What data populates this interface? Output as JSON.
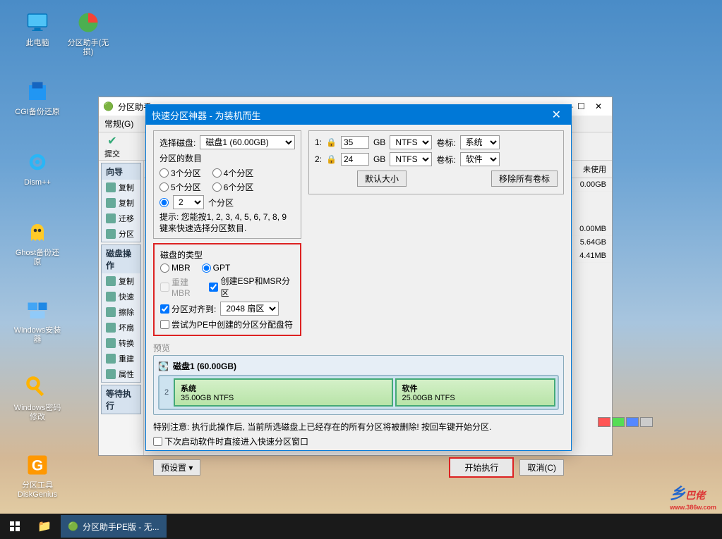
{
  "desktop": {
    "icons": [
      {
        "label": "此电脑",
        "icon": "pc"
      },
      {
        "label": "分区助手(无损)",
        "icon": "partition"
      },
      {
        "label": "CGI备份还原",
        "icon": "cgi"
      },
      {
        "label": "Dism++",
        "icon": "gear"
      },
      {
        "label": "Ghost备份还原",
        "icon": "ghost"
      },
      {
        "label": "Windows安装器",
        "icon": "win-install"
      },
      {
        "label": "Windows密码修改",
        "icon": "key"
      },
      {
        "label": "分区工具DiskGenius",
        "icon": "diskgenius"
      }
    ]
  },
  "taskbar": {
    "app": "分区助手PE版 - 无..."
  },
  "parent_window": {
    "title": "分区助手",
    "menu": [
      "常规(G)"
    ],
    "toolbar_submit": "提交",
    "sidebar": {
      "groups": [
        {
          "head": "向导",
          "items": [
            "复制",
            "复制",
            "迁移",
            "分区"
          ]
        },
        {
          "head": "磁盘操作",
          "items": [
            "复制",
            "快速",
            "擦除",
            "坏扇",
            "转换",
            "重建",
            "属性"
          ]
        },
        {
          "head": "等待执行",
          "items": []
        }
      ]
    },
    "col_unused": "未使用",
    "rows": [
      "0.00GB",
      "0.00MB",
      "5.64GB",
      "4.41MB"
    ]
  },
  "dialog": {
    "title": "快速分区神器 - 为装机而生",
    "select_disk_label": "选择磁盘:",
    "disk_value": "磁盘1 (60.00GB)",
    "partition_count_label": "分区的数目",
    "radio_3": "3个分区",
    "radio_4": "4个分区",
    "radio_5": "5个分区",
    "radio_6": "6个分区",
    "custom_count": "2",
    "custom_suffix": "个分区",
    "hint": "提示: 您能按1, 2, 3, 4, 5, 6, 7, 8, 9键来快速选择分区数目.",
    "disk_type_legend": "磁盘的类型",
    "mbr": "MBR",
    "gpt": "GPT",
    "rebuild_mbr": "重建MBR",
    "create_esp": "创建ESP和MSR分区",
    "align_to": "分区对齐到:",
    "align_value": "2048 扇区",
    "try_pe": "尝试为PE中创建的分区分配盘符",
    "partitions": [
      {
        "num": "1:",
        "size": "35",
        "unit": "GB",
        "fs": "NTFS",
        "vol_label": "卷标:",
        "name": "系统"
      },
      {
        "num": "2:",
        "size": "24",
        "unit": "GB",
        "fs": "NTFS",
        "vol_label": "卷标:",
        "name": "软件"
      }
    ],
    "default_size_btn": "默认大小",
    "remove_labels_btn": "移除所有卷标",
    "preview_label": "预览",
    "preview_disk": "磁盘1 (60.00GB)",
    "preview_num": "2",
    "preview_parts": [
      {
        "name": "系统",
        "detail": "35.00GB NTFS"
      },
      {
        "name": "软件",
        "detail": "25.00GB NTFS"
      }
    ],
    "warning": "特别注意: 执行此操作后, 当前所选磁盘上已经存在的所有分区将被删除! 按回车键开始分区.",
    "next_boot": "下次启动软件时直接进入快速分区窗口",
    "preset_btn": "预设置",
    "execute_btn": "开始执行",
    "cancel_btn": "取消(C)"
  },
  "watermark": "乡巴佬",
  "watermark_url": "www.386w.com"
}
